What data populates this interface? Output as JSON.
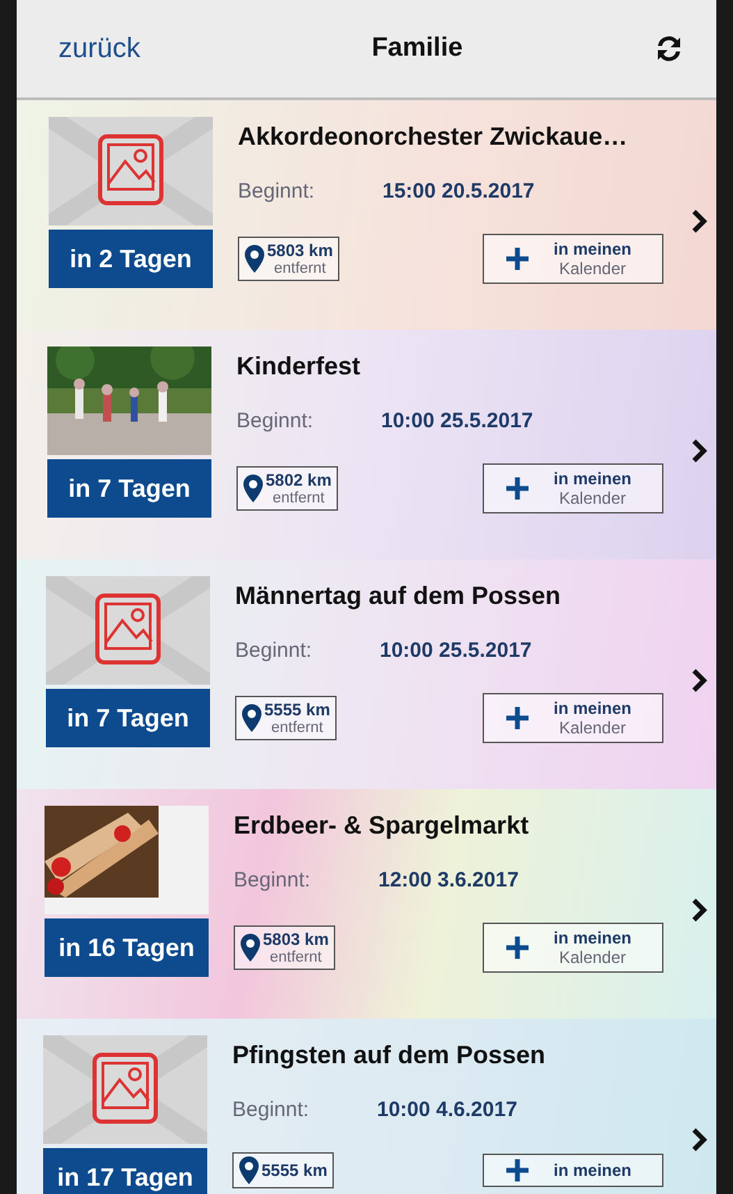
{
  "header": {
    "back": "zurück",
    "title": "Familie"
  },
  "events": [
    {
      "kind": "placeholder",
      "title": "Akkordeonorchester Zwickaue…",
      "start_label": "Beginnt:",
      "start": "15:00 20.5.2017",
      "days": "in 2 Tagen",
      "distance": "5803 km",
      "distance_note": "entfernt",
      "calendar": [
        "in meinen",
        "Kalender"
      ]
    },
    {
      "title": "Kinderfest",
      "start_label": "Beginnt:",
      "start": "10:00 25.5.2017",
      "days": "in 7 Tagen",
      "distance": "5802 km",
      "distance_note": "entfernt",
      "calendar": [
        "in meinen",
        "Kalender"
      ]
    },
    {
      "kind": "placeholder",
      "title": "Männertag auf dem Possen",
      "start_label": "Beginnt:",
      "start": "10:00 25.5.2017",
      "days": "in 7 Tagen",
      "distance": "5555 km",
      "distance_note": "entfernt",
      "calendar": [
        "in meinen",
        "Kalender"
      ]
    },
    {
      "title": "Erdbeer- & Spargelmarkt",
      "start_label": "Beginnt:",
      "start": "12:00 3.6.2017",
      "days": "in 16 Tagen",
      "distance": "5803 km",
      "distance_note": "entfernt",
      "calendar": [
        "in meinen",
        "Kalender"
      ]
    },
    {
      "kind": "placeholder",
      "title": "Pfingsten auf dem Possen",
      "start_label": "Beginnt:",
      "start": "10:00 4.6.2017",
      "days": "in 17 Tagen",
      "distance": "5555 km",
      "calendar": [
        "in meinen"
      ]
    }
  ]
}
